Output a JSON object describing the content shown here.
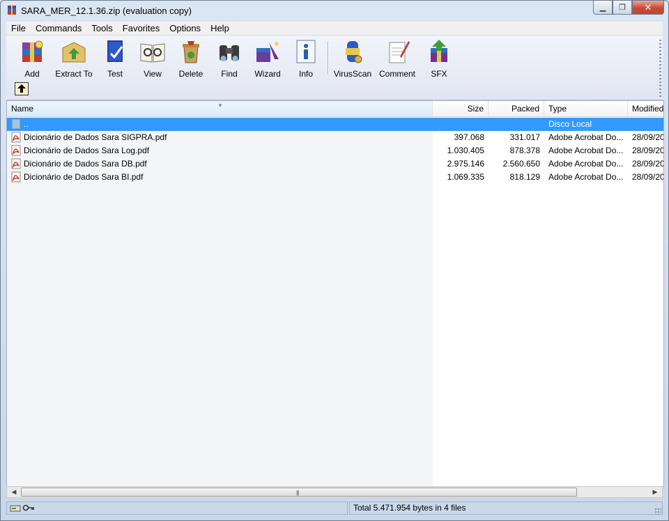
{
  "window": {
    "title": "SARA_MER_12.1.36.zip (evaluation copy)",
    "controls": {
      "minimize": "minimize-icon",
      "maximize": "restore-icon",
      "close": "close-icon"
    }
  },
  "menu": [
    "File",
    "Commands",
    "Tools",
    "Favorites",
    "Options",
    "Help"
  ],
  "toolbar": {
    "buttons": [
      {
        "label": "Add",
        "icon": "add-archive-icon"
      },
      {
        "label": "Extract To",
        "icon": "extract-icon"
      },
      {
        "label": "Test",
        "icon": "test-icon"
      },
      {
        "label": "View",
        "icon": "view-icon"
      },
      {
        "label": "Delete",
        "icon": "delete-icon"
      },
      {
        "label": "Find",
        "icon": "binoculars-icon"
      },
      {
        "label": "Wizard",
        "icon": "wizard-icon"
      },
      {
        "label": "Info",
        "icon": "info-icon"
      },
      {
        "label": "VirusScan",
        "icon": "virus-scan-icon"
      },
      {
        "label": "Comment",
        "icon": "comment-icon"
      },
      {
        "label": "SFX",
        "icon": "sfx-icon"
      }
    ],
    "up_button_icon": "up-folder-icon"
  },
  "columns": {
    "name": "Name",
    "size": "Size",
    "packed": "Packed",
    "type": "Type",
    "modified": "Modified"
  },
  "rows": [
    {
      "name": "..",
      "size": "",
      "packed": "",
      "type": "Disco Local",
      "modified": "",
      "icon": "folder-icon",
      "selected": true
    },
    {
      "name": "Dicionário de Dados Sara SIGPRA.pdf",
      "size": "397.068",
      "packed": "331.017",
      "type": "Adobe Acrobat Do...",
      "modified": "28/09/20",
      "icon": "pdf-icon"
    },
    {
      "name": "Dicionário de Dados Sara Log.pdf",
      "size": "1.030.405",
      "packed": "878.378",
      "type": "Adobe Acrobat Do...",
      "modified": "28/09/20",
      "icon": "pdf-icon"
    },
    {
      "name": "Dicionário de Dados Sara DB.pdf",
      "size": "2.975.146",
      "packed": "2.560.650",
      "type": "Adobe Acrobat Do...",
      "modified": "28/09/20",
      "icon": "pdf-icon"
    },
    {
      "name": "Dicionário de Dados Sara BI.pdf",
      "size": "1.069.335",
      "packed": "818.129",
      "type": "Adobe Acrobat Do...",
      "modified": "28/09/20",
      "icon": "pdf-icon"
    }
  ],
  "status": {
    "total": "Total 5.471.954 bytes in 4 files",
    "left_icons": [
      "drive-icon",
      "key-icon"
    ]
  }
}
